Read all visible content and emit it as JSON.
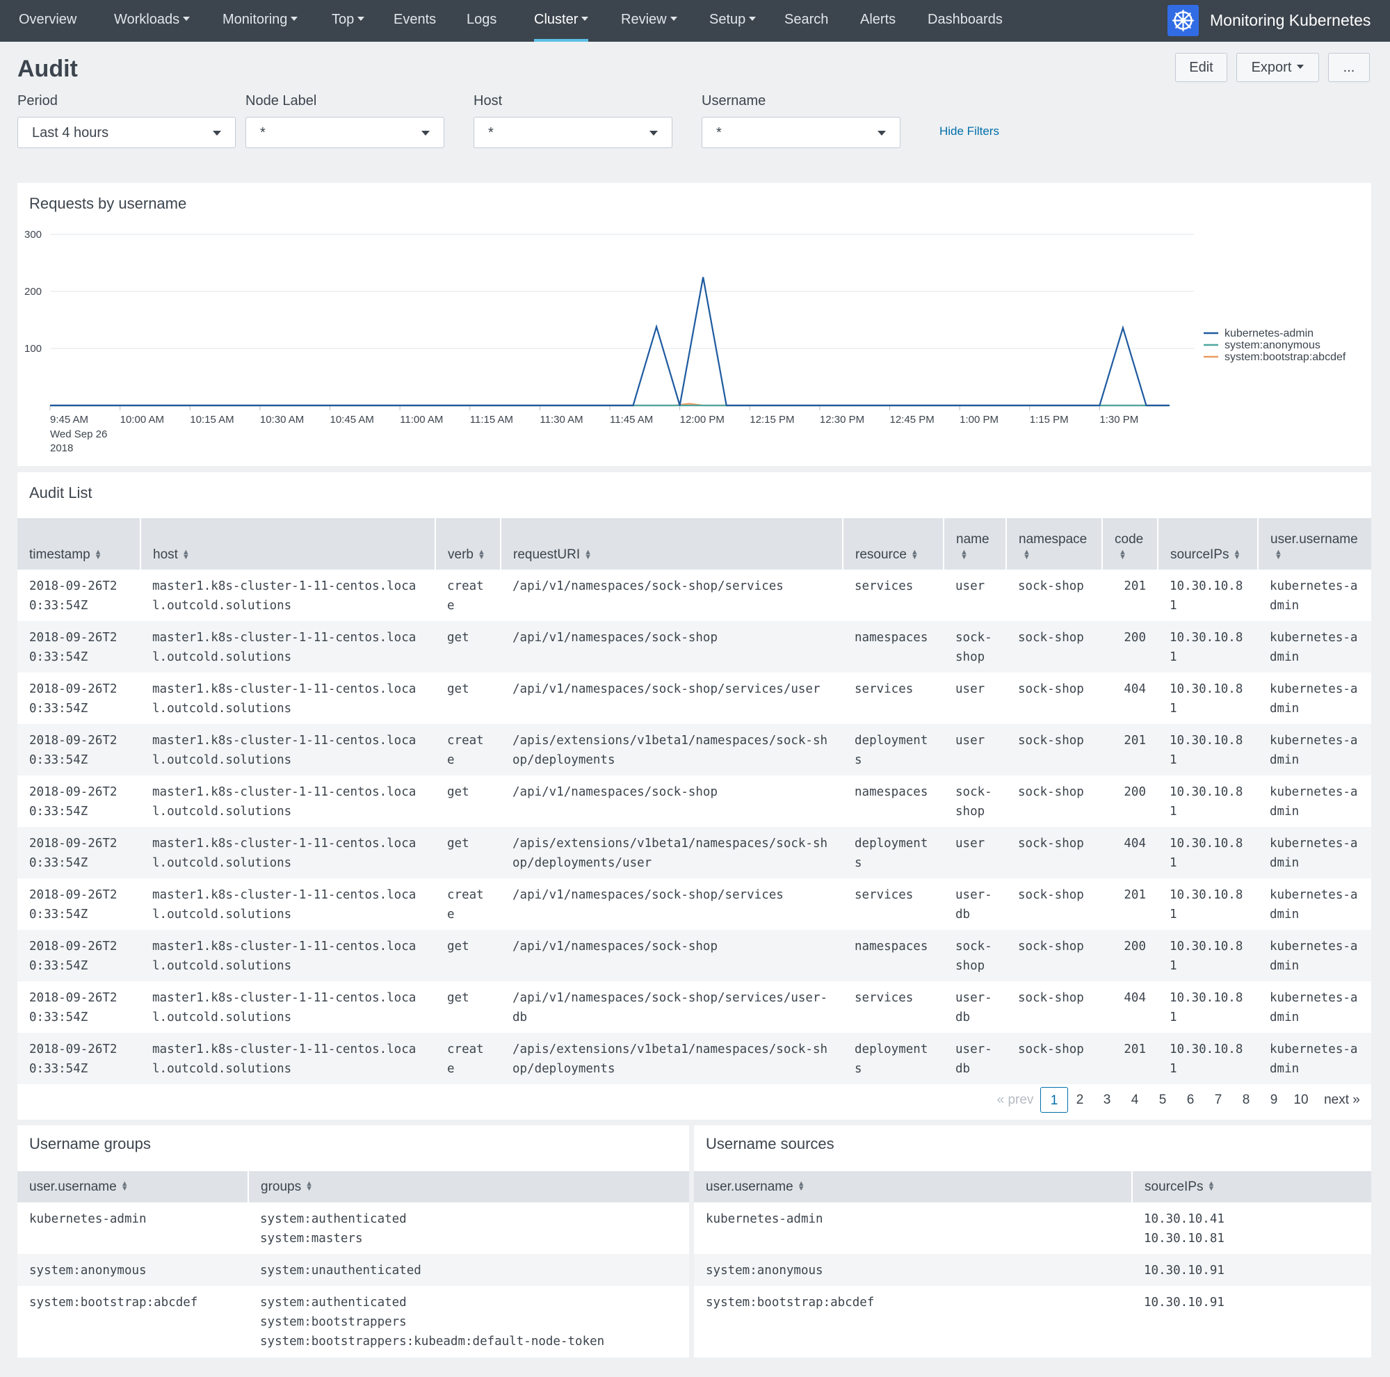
{
  "nav": {
    "items": [
      {
        "label": "Overview",
        "caret": false
      },
      {
        "label": "Workloads",
        "caret": true
      },
      {
        "label": "Monitoring",
        "caret": true
      },
      {
        "label": "Top",
        "caret": true
      },
      {
        "label": "Events",
        "caret": false
      },
      {
        "label": "Logs",
        "caret": false
      },
      {
        "label": "Cluster",
        "caret": true,
        "active": true
      },
      {
        "label": "Review",
        "caret": true
      },
      {
        "label": "Setup",
        "caret": true
      },
      {
        "label": "Search",
        "caret": false
      },
      {
        "label": "Alerts",
        "caret": false
      },
      {
        "label": "Dashboards",
        "caret": false
      }
    ],
    "app_title": "Monitoring Kubernetes"
  },
  "header": {
    "title": "Audit",
    "edit_label": "Edit",
    "export_label": "Export",
    "more_label": "..."
  },
  "filters": {
    "period": {
      "label": "Period",
      "value": "Last 4 hours"
    },
    "node_label": {
      "label": "Node Label",
      "value": "*"
    },
    "host": {
      "label": "Host",
      "value": "*"
    },
    "username": {
      "label": "Username",
      "value": "*"
    },
    "hide_filters": "Hide Filters"
  },
  "chart_panel": {
    "title": "Requests by username"
  },
  "chart_data": {
    "type": "line",
    "title": "Requests by username",
    "ylim": [
      0,
      300
    ],
    "y_ticks": [
      "300",
      "200",
      "100"
    ],
    "x_ticks": [
      "9:45 AM",
      "10:00 AM",
      "10:15 AM",
      "10:30 AM",
      "10:45 AM",
      "11:00 AM",
      "11:15 AM",
      "11:30 AM",
      "11:45 AM",
      "12:00 PM",
      "12:15 PM",
      "12:30 PM",
      "12:45 PM",
      "1:00 PM",
      "1:15 PM",
      "1:30 PM"
    ],
    "x_first_sublabel": [
      "Wed Sep 26",
      "2018"
    ],
    "legend_position": "right",
    "series": [
      {
        "name": "kubernetes-admin",
        "color": "#1e5aa0",
        "values": [
          [
            0,
            0
          ],
          [
            125,
            0
          ],
          [
            130,
            138
          ],
          [
            135,
            0
          ],
          [
            140,
            225
          ],
          [
            145,
            0
          ],
          [
            225,
            0
          ],
          [
            230,
            136
          ],
          [
            235,
            0
          ],
          [
            240,
            0
          ]
        ]
      },
      {
        "name": "system:anonymous",
        "color": "#4ea6a0",
        "values": [
          [
            0,
            0
          ],
          [
            240,
            0
          ]
        ]
      },
      {
        "name": "system:bootstrap:abcdef",
        "color": "#ec9960",
        "values": [
          [
            0,
            0
          ],
          [
            134,
            0
          ],
          [
            137,
            3
          ],
          [
            140,
            0
          ],
          [
            240,
            0
          ]
        ]
      }
    ]
  },
  "audit_list": {
    "title": "Audit List",
    "columns": [
      "timestamp",
      "host",
      "verb",
      "requestURI",
      "resource",
      "name",
      "namespace",
      "code",
      "sourceIPs",
      "user.username"
    ],
    "rows": [
      [
        "2018-09-26T20:33:54Z",
        "master1.k8s-cluster-1-11-centos.local.outcold.solutions",
        "create",
        "/api/v1/namespaces/sock-shop/services",
        "services",
        "user",
        "sock-shop",
        "201",
        "10.30.10.81",
        "kubernetes-admin"
      ],
      [
        "2018-09-26T20:33:54Z",
        "master1.k8s-cluster-1-11-centos.local.outcold.solutions",
        "get",
        "/api/v1/namespaces/sock-shop",
        "namespaces",
        "sock-shop",
        "sock-shop",
        "200",
        "10.30.10.81",
        "kubernetes-admin"
      ],
      [
        "2018-09-26T20:33:54Z",
        "master1.k8s-cluster-1-11-centos.local.outcold.solutions",
        "get",
        "/api/v1/namespaces/sock-shop/services/user",
        "services",
        "user",
        "sock-shop",
        "404",
        "10.30.10.81",
        "kubernetes-admin"
      ],
      [
        "2018-09-26T20:33:54Z",
        "master1.k8s-cluster-1-11-centos.local.outcold.solutions",
        "create",
        "/apis/extensions/v1beta1/namespaces/sock-shop/deployments",
        "deployments",
        "user",
        "sock-shop",
        "201",
        "10.30.10.81",
        "kubernetes-admin"
      ],
      [
        "2018-09-26T20:33:54Z",
        "master1.k8s-cluster-1-11-centos.local.outcold.solutions",
        "get",
        "/api/v1/namespaces/sock-shop",
        "namespaces",
        "sock-shop",
        "sock-shop",
        "200",
        "10.30.10.81",
        "kubernetes-admin"
      ],
      [
        "2018-09-26T20:33:54Z",
        "master1.k8s-cluster-1-11-centos.local.outcold.solutions",
        "get",
        "/apis/extensions/v1beta1/namespaces/sock-shop/deployments/user",
        "deployments",
        "user",
        "sock-shop",
        "404",
        "10.30.10.81",
        "kubernetes-admin"
      ],
      [
        "2018-09-26T20:33:54Z",
        "master1.k8s-cluster-1-11-centos.local.outcold.solutions",
        "create",
        "/api/v1/namespaces/sock-shop/services",
        "services",
        "user-db",
        "sock-shop",
        "201",
        "10.30.10.81",
        "kubernetes-admin"
      ],
      [
        "2018-09-26T20:33:54Z",
        "master1.k8s-cluster-1-11-centos.local.outcold.solutions",
        "get",
        "/api/v1/namespaces/sock-shop",
        "namespaces",
        "sock-shop",
        "sock-shop",
        "200",
        "10.30.10.81",
        "kubernetes-admin"
      ],
      [
        "2018-09-26T20:33:54Z",
        "master1.k8s-cluster-1-11-centos.local.outcold.solutions",
        "get",
        "/api/v1/namespaces/sock-shop/services/user-db",
        "services",
        "user-db",
        "sock-shop",
        "404",
        "10.30.10.81",
        "kubernetes-admin"
      ],
      [
        "2018-09-26T20:33:54Z",
        "master1.k8s-cluster-1-11-centos.local.outcold.solutions",
        "create",
        "/apis/extensions/v1beta1/namespaces/sock-shop/deployments",
        "deployments",
        "user-db",
        "sock-shop",
        "201",
        "10.30.10.81",
        "kubernetes-admin"
      ]
    ],
    "pagination": {
      "prev": "« prev",
      "pages": [
        "1",
        "2",
        "3",
        "4",
        "5",
        "6",
        "7",
        "8",
        "9",
        "10"
      ],
      "current": "1",
      "next": "next »"
    }
  },
  "username_groups": {
    "title": "Username groups",
    "columns": [
      "user.username",
      "groups"
    ],
    "rows": [
      {
        "username": "kubernetes-admin",
        "groups": [
          "system:authenticated",
          "system:masters"
        ]
      },
      {
        "username": "system:anonymous",
        "groups": [
          "system:unauthenticated"
        ]
      },
      {
        "username": "system:bootstrap:abcdef",
        "groups": [
          "system:authenticated",
          "system:bootstrappers",
          "system:bootstrappers:kubeadm:default-node-token"
        ]
      }
    ]
  },
  "username_sources": {
    "title": "Username sources",
    "columns": [
      "user.username",
      "sourceIPs"
    ],
    "rows": [
      {
        "username": "kubernetes-admin",
        "ips": [
          "10.30.10.41",
          "10.30.10.81"
        ]
      },
      {
        "username": "system:anonymous",
        "ips": [
          "10.30.10.91"
        ]
      },
      {
        "username": "system:bootstrap:abcdef",
        "ips": [
          "10.30.10.91"
        ]
      }
    ]
  }
}
